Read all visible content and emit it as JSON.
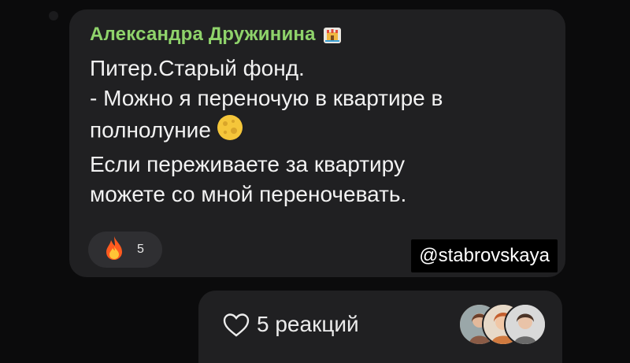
{
  "message": {
    "sender_name": "Александра Дружинина",
    "sender_badge_icon": "castle-badge-icon",
    "lines": [
      "Питер.Старый фонд.",
      "-  Можно я переночую в квартире в",
      "полнолуние",
      "Если переживаете за квартиру",
      "можете со мной переночевать."
    ],
    "moon_emoji": "full-moon-icon",
    "reaction": {
      "emoji": "fire-icon",
      "count": "5"
    }
  },
  "watermark": "@stabrovskaya",
  "reactions_footer": {
    "icon": "heart-outline-icon",
    "label": "5 реакций",
    "avatars": [
      "avatar-1",
      "avatar-2",
      "avatar-3"
    ]
  },
  "colors": {
    "background": "#0b0b0c",
    "bubble": "#202022",
    "sender_name": "#8fd36b",
    "text": "#f2f2f2"
  }
}
